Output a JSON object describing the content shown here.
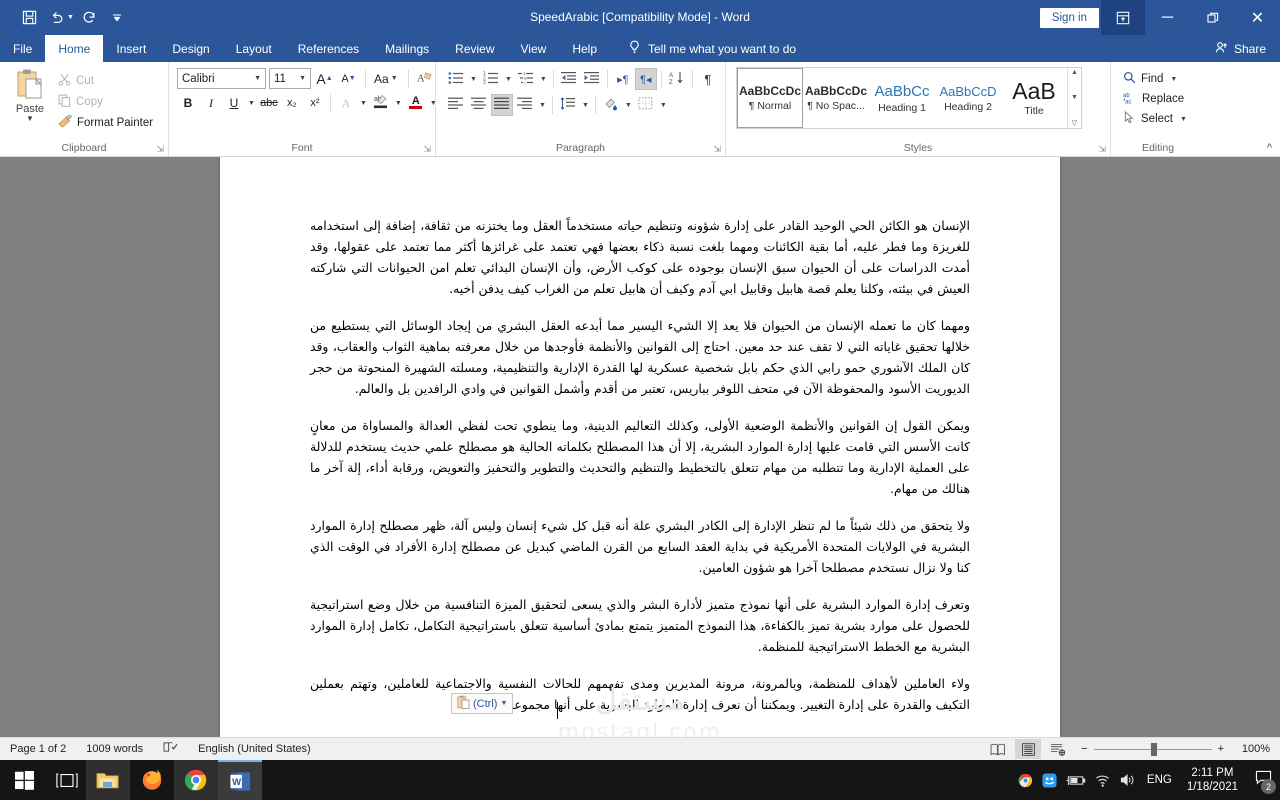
{
  "titlebar": {
    "title": "SpeedArabic [Compatibility Mode]  -  Word",
    "signin": "Sign in",
    "quick_access": [
      "save-icon",
      "undo-icon",
      "redo-icon",
      "customize-qat-icon"
    ],
    "ribbon_display_icon": "ribbon-display-options-icon",
    "minimize": "─",
    "restore": "❐",
    "close": "✕"
  },
  "tabs": [
    {
      "label": "File",
      "active": false
    },
    {
      "label": "Home",
      "active": true
    },
    {
      "label": "Insert",
      "active": false
    },
    {
      "label": "Design",
      "active": false
    },
    {
      "label": "Layout",
      "active": false
    },
    {
      "label": "References",
      "active": false
    },
    {
      "label": "Mailings",
      "active": false
    },
    {
      "label": "Review",
      "active": false
    },
    {
      "label": "View",
      "active": false
    },
    {
      "label": "Help",
      "active": false
    }
  ],
  "tellme": {
    "label": "Tell me what you want to do",
    "icon": "lightbulb-icon"
  },
  "share": {
    "label": "Share",
    "icon": "share-person-icon"
  },
  "ribbon": {
    "clipboard": {
      "group_label": "Clipboard",
      "paste_label": "Paste",
      "items": [
        {
          "label": "Cut",
          "icon": "scissors-icon",
          "enabled": false
        },
        {
          "label": "Copy",
          "icon": "copy-icon",
          "enabled": false
        },
        {
          "label": "Format Painter",
          "icon": "format-painter-icon",
          "enabled": true
        }
      ]
    },
    "font": {
      "group_label": "Font",
      "font_name": "Calibri",
      "font_size": "11",
      "grow_font": "A",
      "shrink_font": "A",
      "change_case": "Aa",
      "clear_formatting": "clear-formatting-icon",
      "bold": "B",
      "italic": "I",
      "underline": "U",
      "strikethrough": "abc",
      "subscript": "x₂",
      "superscript": "x²",
      "text_effects": "A",
      "highlight": "ab",
      "font_color": "A",
      "font_color_hex": "#d10000"
    },
    "paragraph": {
      "group_label": "Paragraph",
      "bullets": "bullets-icon",
      "numbering": "numbering-icon",
      "multilevel": "multilevel-list-icon",
      "decrease_indent": "decrease-indent-icon",
      "increase_indent": "increase-indent-icon",
      "ltr": "▸¶",
      "rtl": "¶◂",
      "sort": "sort-icon",
      "show_marks": "¶",
      "align_left": "align-left-icon",
      "align_center": "align-center-icon",
      "align_justify": "align-justify-icon",
      "align_right": "align-right-icon",
      "line_spacing": "line-spacing-icon",
      "shading": "shading-icon",
      "borders": "borders-icon"
    },
    "styles": {
      "group_label": "Styles",
      "items": [
        {
          "preview": "AaBbCcDc",
          "name": "¶ Normal",
          "selected": true,
          "color": "#2d2d2d",
          "size": "12px"
        },
        {
          "preview": "AaBbCcDc",
          "name": "¶ No Spac...",
          "selected": false,
          "color": "#2d2d2d",
          "size": "12px"
        },
        {
          "preview": "AaBbCс",
          "name": "Heading 1",
          "selected": false,
          "color": "#2e74b5",
          "size": "15px"
        },
        {
          "preview": "AaBbCcD",
          "name": "Heading 2",
          "selected": false,
          "color": "#2e74b5",
          "size": "13px"
        },
        {
          "preview": "AaB",
          "name": "Title",
          "selected": false,
          "color": "#1a1a1a",
          "size": "22px"
        }
      ]
    },
    "editing": {
      "group_label": "Editing",
      "items": [
        {
          "label": "Find",
          "icon": "search-icon",
          "has_caret": true
        },
        {
          "label": "Replace",
          "icon": "replace-icon",
          "has_caret": false
        },
        {
          "label": "Select",
          "icon": "cursor-select-icon",
          "has_caret": true
        }
      ]
    },
    "collapse": "collapse-ribbon-icon"
  },
  "document": {
    "paragraphs": [
      "الإنسان هو الكائن الحي الوحيد القادر على إدارة شؤونه وتنظيم حياته مستخدماً العقل وما يختزنه من ثقافة، إضافة إلى استخدامه للغريزة وما فطر عليه، أما بقية الكائنات ومهما بلغت نسبة ذكاء بعضها فهي تعتمد على غرائزها أكثر مما تعتمد على عقولها، وقد أمدت الدراسات على أن الحيوان سبق الإنسان بوجوده على كوكب الأرض، وأن الإنسان البدائي تعلم امن الحيوانات التي شاركته العيش في بيئته، وكلنا يعلم قصة هابيل وقابيل ابي آدم وكيف أن هابيل تعلم من الغراب كيف يدفن أخيه.",
      "ومهما كان ما تعمله الإنسان من الحيوان فلا يعد إلا الشيء اليسير مما أبدعه العقل البشري من إيجاد الوسائل التي يستطيع من خلالها تحقيق غاياته التي لا تقف عند حد معين.  احتاج إلى القوانين والأنظمة فأوجدها من خلال معرفته بماهية الثواب والعقاب، وقد كان الملك الآشوري حمو رابي الذي حكم بابل شخصية عسكرية لها القدرة الإدارية والتنظيمية، ومسلته الشهيرة المنحوتة من حجر الديوريت الأسود والمحفوظة الآن في متحف اللوفر بباريس، تعتبر من أقدم وأشمل القوانين في وادي الرافدين بل والعالم.",
      "ويمكن القول إن القوانين والأنظمة الوضعية الأولى، وكذلك التعاليم الدينية، وما ينطوي تحت لفظي العدالة والمساواة من معانٍ كانت الأسس التي قامت عليها إدارة الموارد البشرية، إلا أن هذا المصطلح بكلماته الحالية هو مصطلح علمي حديث يستخدم للدلالة على العملية الإدارية وما تتطلبه من مهام تتعلق بالتخطيط والتنظيم والتحديث والتطوير والتحفيز والتعويض، ورقابة أداء، إلة آخر ما هنالك من مهام.",
      "ولا يتحقق من ذلك شيئاً ما لم تنظر الإدارة إلى الكادر البشري علة أنه قبل كل شيء إنسان وليس آلة، ظهر مصطلح إدارة الموارد البشرية في الولايات المتحدة الأمريكية في بداية العقد السابع من القرن الماضي كبديل عن مصطلح إدارة الأفراد في الوقت الذي كنا ولا نزال نستخدم مصطلحا آخرا هو شؤون العامين.",
      "وتعرف إدارة الموارد البشرية على أنها نموذج متميز لأدارة البشر والذي يسعى لتحقيق الميزة التنافسية من خلال وضع استراتيجية للحصول على موارد بشرية تميز بالكفاءة، هذا النموذج المتميز يتمتع بمادئ أساسية تتعلق باستراتيجية التكامل، تكامل إدارة الموارد البشرية مع الخطط الاستراتيجية للمنظمة.",
      "ولاء العاملين لأهداف للمنظمة، وبالمرونة، مرونة المديرين ومدى تفهمهم للحالات النفسية والاجتماعية للعاملين، وتهتم بعملين التكيف والقدرة على إدارة التغيير. ويمكننا أن نعرف إدارة الموارد البشرية على أنها مجموعة وظائف"
    ],
    "paste_options": {
      "label": "(Ctrl)",
      "icon": "clipboard-paste-icon"
    },
    "watermark_line1": "مستقل",
    "watermark_line2": "mostaql.com"
  },
  "statusbar": {
    "page": "Page 1 of 2",
    "words": "1009 words",
    "proofing_icon": "proofing-errors-icon",
    "language": "English (United States)",
    "views": [
      {
        "icon": "read-mode-icon",
        "active": false
      },
      {
        "icon": "print-layout-icon",
        "active": true
      },
      {
        "icon": "web-layout-icon",
        "active": false
      }
    ],
    "zoom_out": "−",
    "zoom_in": "+",
    "zoom_level": "100%"
  },
  "taskbar": {
    "start": "windows-start-icon",
    "task_view": "task-view-icon",
    "apps": [
      {
        "name": "file-explorer-icon",
        "state": "open"
      },
      {
        "name": "firefox-icon",
        "state": "closed"
      },
      {
        "name": "google-chrome-icon",
        "state": "open"
      },
      {
        "name": "microsoft-word-icon",
        "state": "active"
      }
    ],
    "tray": [
      {
        "name": "chrome-tray-icon"
      },
      {
        "name": "messenger-tray-icon"
      },
      {
        "name": "battery-charging-icon"
      },
      {
        "name": "wifi-icon"
      },
      {
        "name": "volume-icon"
      }
    ],
    "language": "ENG",
    "time": "2:11 PM",
    "date": "1/18/2021",
    "notifications_count": "2"
  }
}
